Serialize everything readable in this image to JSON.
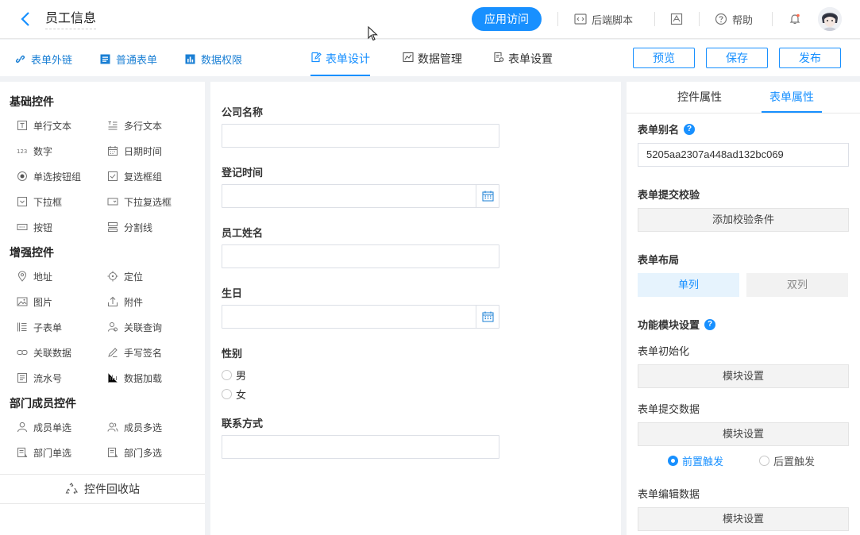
{
  "header": {
    "title": "员工信息",
    "visit_button": "应用访问",
    "backend_script": "后端脚本",
    "help": "帮助"
  },
  "subbar": {
    "links": [
      {
        "label": "表单外链",
        "icon": "link-icon"
      },
      {
        "label": "普通表单",
        "icon": "form-icon"
      },
      {
        "label": "数据权限",
        "icon": "chart-icon"
      }
    ],
    "tabs": [
      {
        "label": "表单设计",
        "icon": "edit-icon",
        "active": true
      },
      {
        "label": "数据管理",
        "icon": "trend-icon",
        "active": false
      },
      {
        "label": "表单设置",
        "icon": "settings-doc-icon",
        "active": false
      }
    ],
    "buttons": {
      "preview": "预览",
      "save": "保存",
      "publish": "发布"
    }
  },
  "left": {
    "groups": [
      {
        "title": "基础控件",
        "items": [
          "单行文本",
          "多行文本",
          "数字",
          "日期时间",
          "单选按钮组",
          "复选框组",
          "下拉框",
          "下拉复选框",
          "按钮",
          "分割线"
        ]
      },
      {
        "title": "增强控件",
        "items": [
          "地址",
          "定位",
          "图片",
          "附件",
          "子表单",
          "关联查询",
          "关联数据",
          "手写签名",
          "流水号",
          "数据加载"
        ]
      },
      {
        "title": "部门成员控件",
        "items": [
          "成员单选",
          "成员多选",
          "部门单选",
          "部门多选"
        ]
      }
    ],
    "recycle": "控件回收站"
  },
  "canvas": {
    "fields": [
      {
        "label": "公司名称",
        "type": "text"
      },
      {
        "label": "登记时间",
        "type": "date"
      },
      {
        "label": "员工姓名",
        "type": "text"
      },
      {
        "label": "生日",
        "type": "date"
      },
      {
        "label": "性别",
        "type": "radio",
        "options": [
          "男",
          "女"
        ]
      },
      {
        "label": "联系方式",
        "type": "text"
      }
    ]
  },
  "right": {
    "tabs": [
      "控件属性",
      "表单属性"
    ],
    "alias_label": "表单别名",
    "alias_value": "5205aa2307a448ad132bc069",
    "validate_label": "表单提交校验",
    "validate_button": "添加校验条件",
    "layout_label": "表单布局",
    "layout_single": "单列",
    "layout_double": "双列",
    "module_label": "功能模块设置",
    "init_label": "表单初始化",
    "module_button": "模块设置",
    "submit_label": "表单提交数据",
    "trigger_before": "前置触发",
    "trigger_after": "后置触发",
    "edit_label": "表单编辑数据"
  },
  "colors": {
    "accent": "#1890ff",
    "link": "#1a7fd4"
  }
}
